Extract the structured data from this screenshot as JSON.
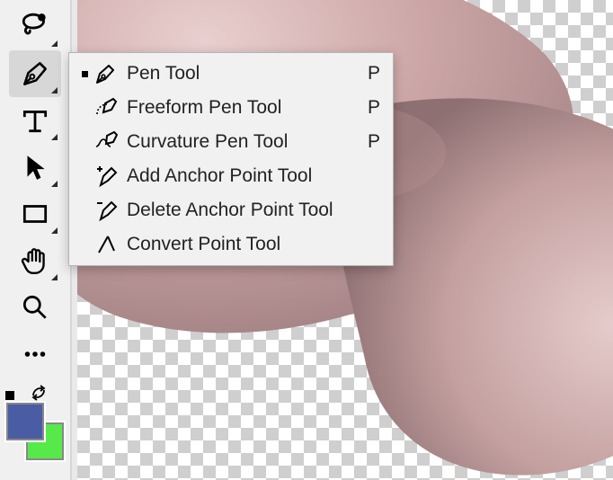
{
  "toolbar": {
    "tools": [
      {
        "name": "magnifier",
        "selected": false
      },
      {
        "name": "pen",
        "selected": true
      },
      {
        "name": "type",
        "selected": false
      },
      {
        "name": "path-selection",
        "selected": false
      },
      {
        "name": "rectangle",
        "selected": false
      },
      {
        "name": "hand",
        "selected": false
      },
      {
        "name": "zoom",
        "selected": false
      },
      {
        "name": "more",
        "selected": false
      }
    ],
    "colors": {
      "foreground": "#4a5da4",
      "background": "#57e94a"
    }
  },
  "flyout": {
    "items": [
      {
        "label": "Pen Tool",
        "shortcut": "P",
        "current": true,
        "icon": "pen"
      },
      {
        "label": "Freeform Pen Tool",
        "shortcut": "P",
        "current": false,
        "icon": "freeform-pen"
      },
      {
        "label": "Curvature Pen Tool",
        "shortcut": "P",
        "current": false,
        "icon": "curvature-pen"
      },
      {
        "label": "Add Anchor Point Tool",
        "shortcut": "",
        "current": false,
        "icon": "add-anchor"
      },
      {
        "label": "Delete Anchor Point Tool",
        "shortcut": "",
        "current": false,
        "icon": "delete-anchor"
      },
      {
        "label": "Convert Point Tool",
        "shortcut": "",
        "current": false,
        "icon": "convert-point"
      }
    ]
  }
}
